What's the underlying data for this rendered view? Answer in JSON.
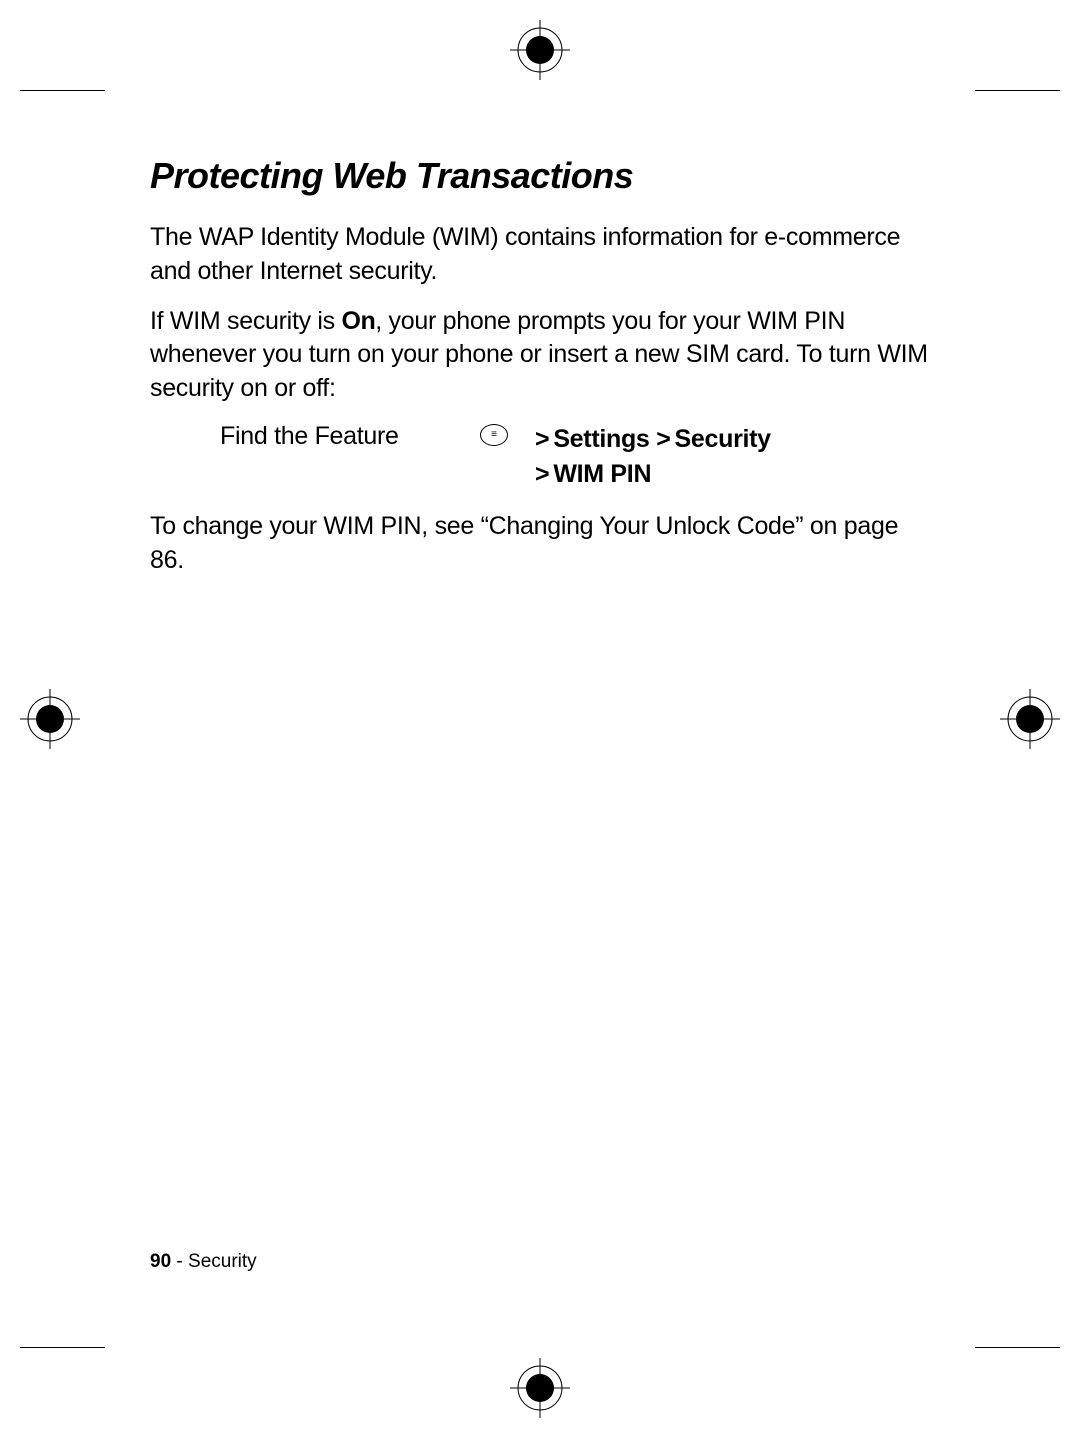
{
  "document": {
    "heading": "Protecting Web Transactions",
    "para1": "The WAP Identity Module (WIM) contains information for e-commerce and other Internet security.",
    "para2_pre": "If WIM security is ",
    "para2_on": "On",
    "para2_post": ", your phone prompts you for your WIM PIN whenever you turn on your phone or insert a new SIM card. To turn WIM security on or off:",
    "feature_label": "Find the Feature",
    "menu_path_line1_a": "Settings",
    "menu_path_line1_b": "Security",
    "menu_path_line2": "WIM PIN",
    "para3": "To change your WIM PIN, see “Changing Your Unlock Code” on page 86.",
    "footer_page": "90",
    "footer_sep": " - ",
    "footer_section": "Security"
  }
}
